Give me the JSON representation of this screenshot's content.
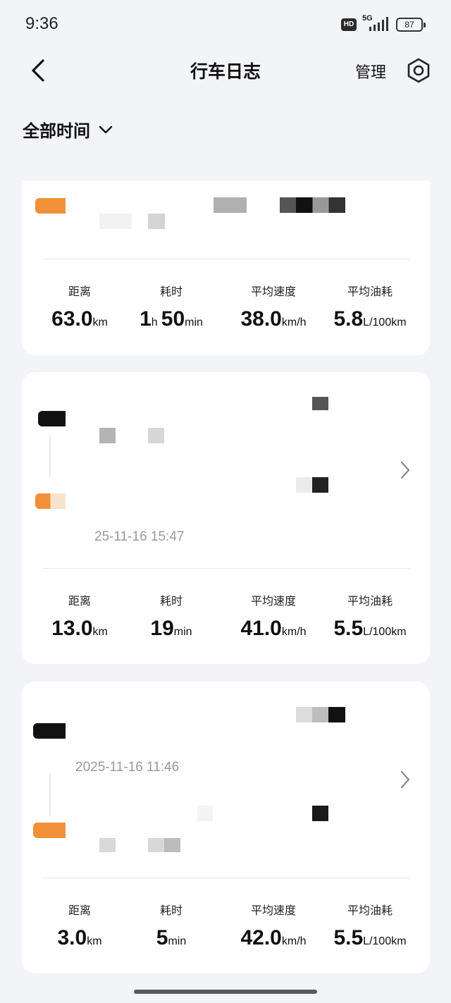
{
  "status_bar": {
    "time": "9:36",
    "hd": "HD",
    "network": "5G",
    "battery": "87"
  },
  "header": {
    "title": "行车日志",
    "manage_label": "管理"
  },
  "filter": {
    "label": "全部时间"
  },
  "trips": [
    {
      "stats": [
        {
          "label": "距离",
          "value": "63.0",
          "unit": "km"
        },
        {
          "label": "耗时",
          "value_h": "1",
          "unit_h": "h",
          "value_m": "50",
          "unit_m": "min"
        },
        {
          "label": "平均速度",
          "value": "38.0",
          "unit": "km/h"
        },
        {
          "label": "平均油耗",
          "value": "5.8",
          "unit": "L/100km"
        }
      ]
    },
    {
      "end_time": "25-11-16 15:47",
      "stats": [
        {
          "label": "距离",
          "value": "13.0",
          "unit": "km"
        },
        {
          "label": "耗时",
          "value": "19",
          "unit": "min"
        },
        {
          "label": "平均速度",
          "value": "41.0",
          "unit": "km/h"
        },
        {
          "label": "平均油耗",
          "value": "5.5",
          "unit": "L/100km"
        }
      ]
    },
    {
      "start_time": "2025-11-16 11:46",
      "stats": [
        {
          "label": "距离",
          "value": "3.0",
          "unit": "km"
        },
        {
          "label": "耗时",
          "value": "5",
          "unit": "min"
        },
        {
          "label": "平均速度",
          "value": "42.0",
          "unit": "km/h"
        },
        {
          "label": "平均油耗",
          "value": "5.5",
          "unit": "L/100km"
        }
      ]
    }
  ],
  "colors": {
    "accent_orange": "#f0913a",
    "background": "#f3f4f8",
    "card": "#ffffff"
  }
}
